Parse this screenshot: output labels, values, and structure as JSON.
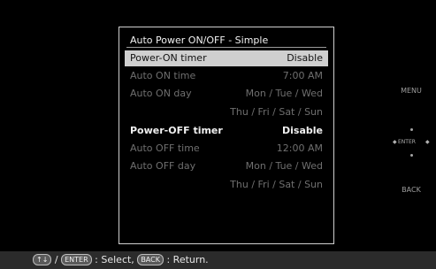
{
  "dialog": {
    "title": "Auto Power ON/OFF - Simple",
    "rows": [
      {
        "label": "Power-ON timer",
        "value": "Disable"
      },
      {
        "label": "Auto ON time",
        "value": "7:00 AM"
      },
      {
        "label": "Auto ON day",
        "value": "Mon / Tue / Wed"
      },
      {
        "label": "",
        "value": "Thu / Fri / Sat / Sun"
      },
      {
        "label": "Power-OFF timer",
        "value": "Disable"
      },
      {
        "label": "Auto OFF time",
        "value": "12:00 AM"
      },
      {
        "label": "Auto OFF day",
        "value": "Mon / Tue / Wed"
      },
      {
        "label": "",
        "value": "Thu / Fri / Sat / Sun"
      }
    ]
  },
  "side": {
    "menu_label": "MENU",
    "enter_label": "ENTER",
    "back_label": "BACK"
  },
  "bottom": {
    "arrows_key": "↑↓",
    "sep": "/",
    "enter_key": "ENTER",
    "select_text": ": Select,",
    "back_key": "BACK",
    "return_text": ": Return."
  }
}
